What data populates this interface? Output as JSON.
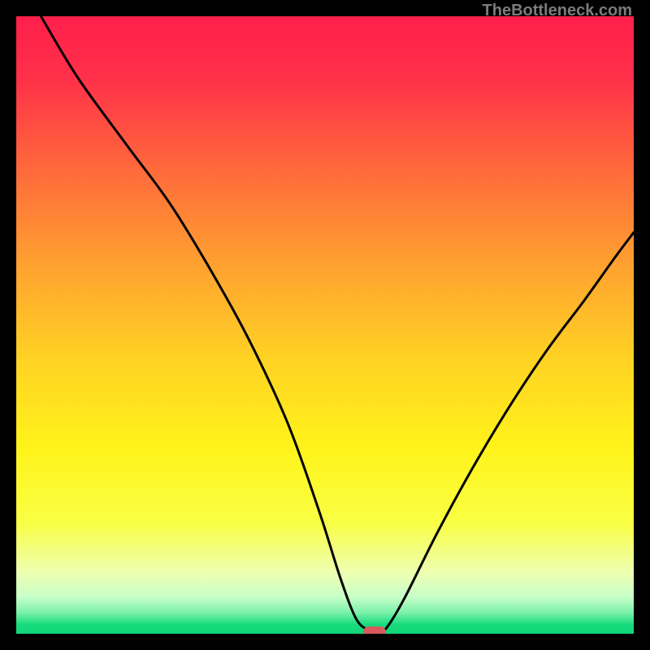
{
  "watermark": "TheBottleneck.com",
  "chart_data": {
    "type": "line",
    "title": "",
    "xlabel": "",
    "ylabel": "",
    "xlim": [
      0,
      100
    ],
    "ylim": [
      0,
      100
    ],
    "background_gradient_stops": [
      {
        "pos": 0.0,
        "color": "#ff1f4b"
      },
      {
        "pos": 0.1,
        "color": "#ff3049"
      },
      {
        "pos": 0.25,
        "color": "#ff6a3b"
      },
      {
        "pos": 0.4,
        "color": "#ffa030"
      },
      {
        "pos": 0.55,
        "color": "#ffd124"
      },
      {
        "pos": 0.7,
        "color": "#fff31a"
      },
      {
        "pos": 0.82,
        "color": "#f9ff44"
      },
      {
        "pos": 0.9,
        "color": "#eeffb0"
      },
      {
        "pos": 0.94,
        "color": "#c9ffc9"
      },
      {
        "pos": 0.965,
        "color": "#7ef2ab"
      },
      {
        "pos": 0.985,
        "color": "#18db7d"
      },
      {
        "pos": 1.0,
        "color": "#0fd676"
      }
    ],
    "series": [
      {
        "name": "bottleneck-curve",
        "color": "#000000",
        "x": [
          4,
          10,
          18,
          25,
          32,
          38,
          44,
          49,
          52.5,
          55,
          57,
          58.5,
          60,
          63,
          68,
          74,
          80,
          86,
          92,
          97,
          100
        ],
        "y": [
          100,
          90,
          79,
          69.5,
          58,
          47,
          34,
          20,
          9,
          2.5,
          0.6,
          0.3,
          1,
          6,
          16,
          27,
          37,
          46,
          54,
          61,
          65
        ]
      }
    ],
    "marker": {
      "x": 58,
      "y": 0.3,
      "color": "#d85a5c"
    }
  }
}
